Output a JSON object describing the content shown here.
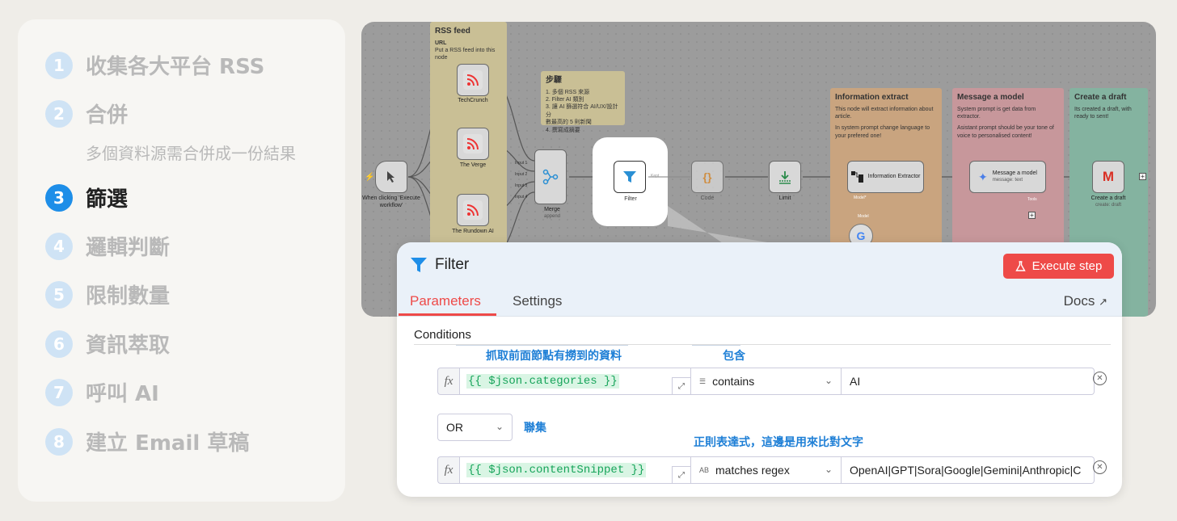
{
  "steps": [
    {
      "num": "1",
      "label": "收集各大平台 RSS"
    },
    {
      "num": "2",
      "label": "合併"
    },
    {
      "num": "3",
      "label": "篩選"
    },
    {
      "num": "4",
      "label": "邏輯判斷"
    },
    {
      "num": "5",
      "label": "限制數量"
    },
    {
      "num": "6",
      "label": "資訊萃取"
    },
    {
      "num": "7",
      "label": "呼叫 AI"
    },
    {
      "num": "8",
      "label": "建立 Email 草稿"
    }
  ],
  "step2_sub": "多個資料源需合併成一份結果",
  "active_step": "3",
  "workflow": {
    "rss_sticky": {
      "title": "RSS feed",
      "line1": "URL",
      "line2": "Put a RSS feed into this node"
    },
    "steps_sticky": {
      "title": "步驟",
      "lines": [
        "1. 多個 RSS 來源",
        "2. Filter AI 類別",
        "3. 讓 AI 篩選符合 AI/UX/設計分",
        "   數最高的 5 則新聞",
        "4. 撰寫成摘要"
      ]
    },
    "info_sticky": {
      "title": "Information extract",
      "line1": "This node will extract information about article.",
      "line2": "In system prompt change language to your prefered one!"
    },
    "msg_sticky": {
      "title": "Message a model",
      "line1": "System prompt is get data from extractor.",
      "line2": "Asistant prompt should be your tone of voice to personalised content!"
    },
    "draft_sticky": {
      "title": "Create a draft",
      "line1": "Its created a draft, with ready to sent!"
    },
    "trigger_label": "When clicking 'Execute workflow'",
    "techcrunch": "TechCrunch",
    "verge": "The Verge",
    "rundown": "The Rundown AI",
    "merge": "Merge",
    "merge_sub": "append",
    "merge_inputs": [
      "Input 1",
      "Input 2",
      "Input 3",
      "Input 4"
    ],
    "filter": "Filter",
    "kept": "Kept",
    "code": "Code",
    "limit": "Limit",
    "extractor": "Information Extractor",
    "model_label": "Model*",
    "model": "Model",
    "message_model": "Message a model",
    "message_sub": "message: text",
    "tools": "Tools",
    "create_draft": "Create a draft",
    "create_draft_sub": "create: draft"
  },
  "panel": {
    "title": "Filter",
    "execute_label": "Execute step",
    "tab_parameters": "Parameters",
    "tab_settings": "Settings",
    "docs": "Docs",
    "conditions": "Conditions",
    "note1": "抓取前面節點有撈到的資料",
    "note2": "包含",
    "note3": "聯集",
    "note4": "正則表達式，這邊是用來比對文字",
    "cond1": {
      "expr": "{{ $json.categories }}",
      "op": "contains",
      "value": "AI"
    },
    "combinator": "OR",
    "cond2": {
      "expr": "{{ $json.contentSnippet }}",
      "op_icon": "AB",
      "op": "matches regex",
      "value": "OpenAI|GPT|Sora|Google|Gemini|Anthropic|C"
    }
  },
  "colors": {
    "accent": "#ee4a48",
    "note_blue": "#1e7fd6",
    "step_active": "#1e8ee8",
    "step_inactive": "#cfe3f5",
    "code_green": "#17a45a"
  }
}
